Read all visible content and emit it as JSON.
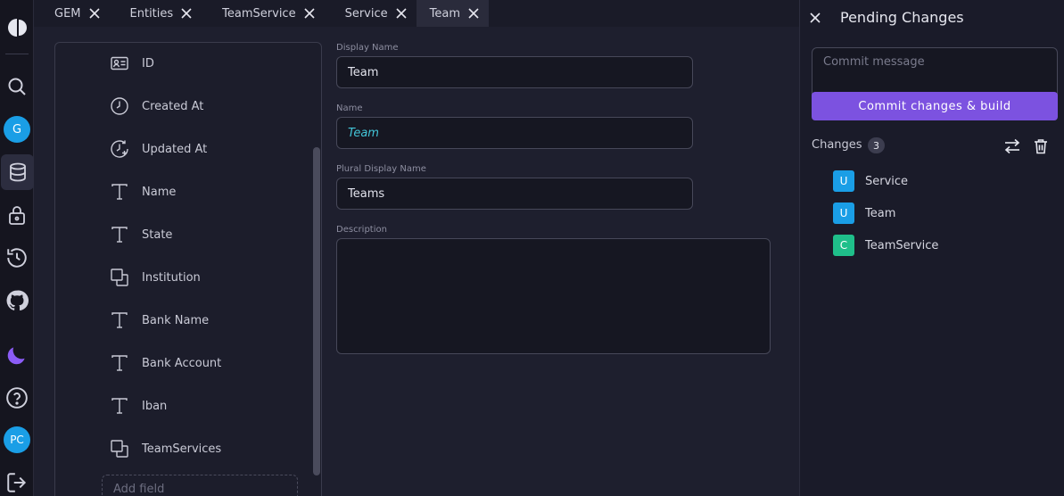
{
  "tabs": [
    {
      "label": "GEM"
    },
    {
      "label": "Entities"
    },
    {
      "label": "TeamService"
    },
    {
      "label": "Service"
    },
    {
      "label": "Team"
    }
  ],
  "sidebar": {
    "workspace_avatar": "G",
    "user_avatar": "PC",
    "icons": [
      "logo-icon",
      "search-icon",
      "workspace-avatar",
      "database-icon",
      "lock-icon",
      "history-icon",
      "github-icon",
      "moon-icon",
      "help-icon",
      "user-avatar",
      "logout-icon"
    ]
  },
  "fields": {
    "items": [
      {
        "label": "ID",
        "icon": "id-card-icon"
      },
      {
        "label": "Created At",
        "icon": "clock-icon"
      },
      {
        "label": "Updated At",
        "icon": "clock-refresh-icon"
      },
      {
        "label": "Name",
        "icon": "text-type-icon"
      },
      {
        "label": "State",
        "icon": "text-type-icon"
      },
      {
        "label": "Institution",
        "icon": "relation-icon"
      },
      {
        "label": "Bank Name",
        "icon": "text-type-icon"
      },
      {
        "label": "Bank Account",
        "icon": "text-type-icon"
      },
      {
        "label": "Iban",
        "icon": "text-type-icon"
      },
      {
        "label": "TeamServices",
        "icon": "relation-icon"
      }
    ],
    "add_field_placeholder": "Add field"
  },
  "form": {
    "display_name_label": "Display Name",
    "display_name_value": "Team",
    "name_label": "Name",
    "name_value": "Team",
    "plural_label": "Plural Display Name",
    "plural_value": "Teams",
    "description_label": "Description",
    "description_value": ""
  },
  "pending": {
    "title": "Pending Changes",
    "commit_placeholder": "Commit message",
    "commit_button": "Commit changes & build",
    "changes_label": "Changes",
    "changes_count": "3",
    "changes": [
      {
        "badge": "U",
        "name": "Service",
        "color": "#1a9ee6"
      },
      {
        "badge": "U",
        "name": "Team",
        "color": "#1a9ee6"
      },
      {
        "badge": "C",
        "name": "TeamService",
        "color": "#1fbf8a"
      }
    ]
  },
  "colors": {
    "accent": "#7c52e0",
    "update_badge": "#1a9ee6",
    "create_badge": "#1fbf8a",
    "moon": "#8b5cf6"
  }
}
